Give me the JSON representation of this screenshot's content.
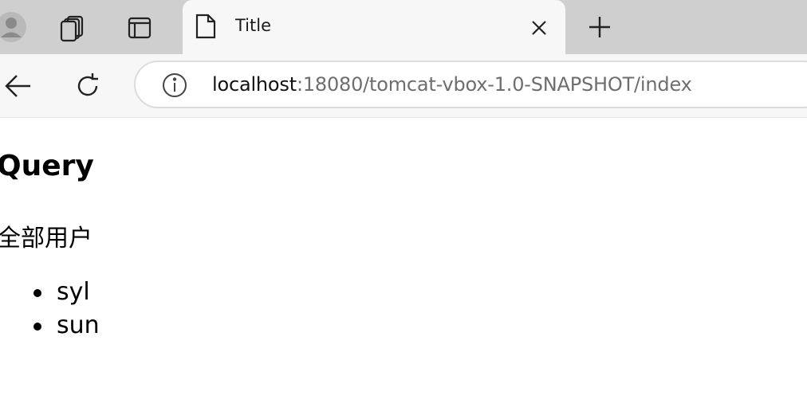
{
  "tab": {
    "title": "Title",
    "favicon": "page-icon"
  },
  "address_bar": {
    "host": "localhost",
    "path": ":18080/tomcat-vbox-1.0-SNAPSHOT/index",
    "icon": "info-icon"
  },
  "page": {
    "heading": "Query",
    "section_label": "全部用户",
    "users": [
      "syl",
      "sun"
    ]
  },
  "colors": {
    "tabstrip_bg": "#cfcfcf",
    "toolbar_bg": "#f7f7f7",
    "url_path": "#6e6e6e"
  }
}
